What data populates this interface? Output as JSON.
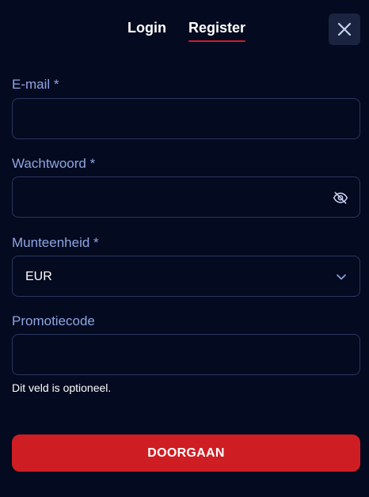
{
  "tabs": {
    "login": "Login",
    "register": "Register",
    "active": "register"
  },
  "close": {
    "icon": "close-icon"
  },
  "form": {
    "email": {
      "label": "E-mail *",
      "value": "",
      "placeholder": ""
    },
    "password": {
      "label": "Wachtwoord *",
      "value": "",
      "placeholder": "",
      "icon": "eye-off-icon"
    },
    "currency": {
      "label": "Munteenheid *",
      "selected": "EUR",
      "icon": "chevron-down-icon"
    },
    "promo": {
      "label": "Promotiecode",
      "value": "",
      "placeholder": "",
      "helper": "Dit veld is optioneel."
    }
  },
  "submit": {
    "label": "DOORGAAN"
  },
  "colors": {
    "background": "#040a1f",
    "label": "#8fa6e3",
    "border": "#2a3760",
    "accent": "#cf1e23",
    "close_bg": "#1a2340"
  }
}
